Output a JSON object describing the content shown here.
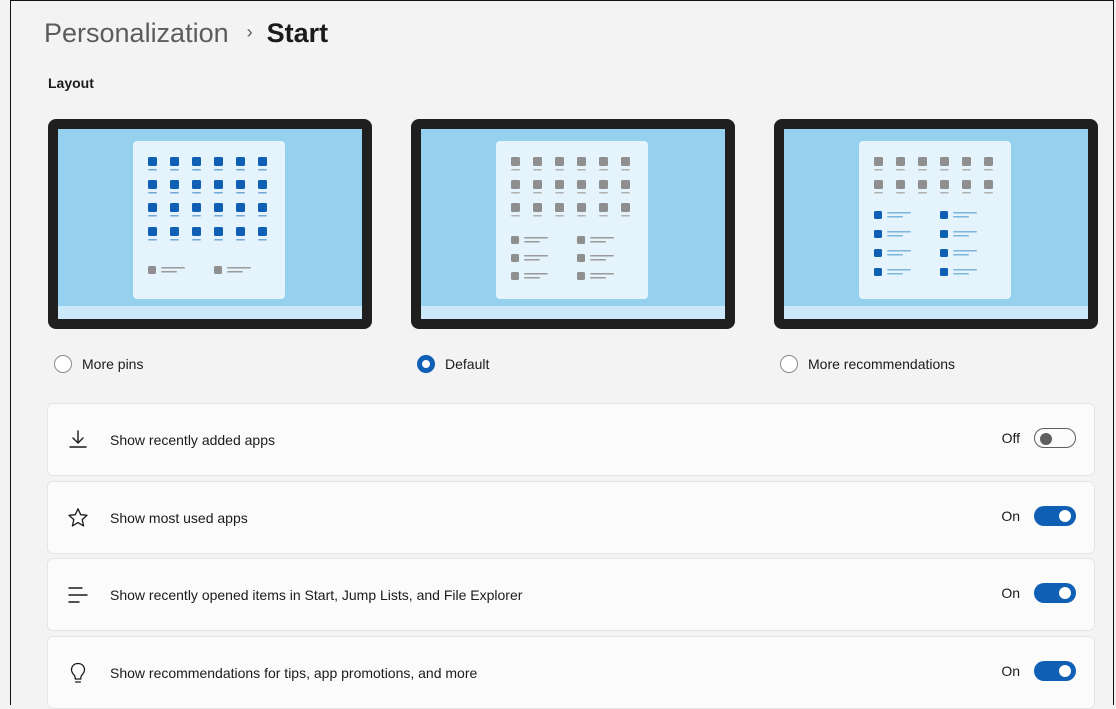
{
  "header": {
    "breadcrumb_parent": "Personalization",
    "breadcrumb_separator": "›",
    "breadcrumb_current": "Start"
  },
  "layout_section": {
    "label": "Layout",
    "options": [
      {
        "label": "More pins",
        "selected": false
      },
      {
        "label": "Default",
        "selected": true
      },
      {
        "label": "More recommendations",
        "selected": false
      }
    ]
  },
  "settings": [
    {
      "icon": "download-icon",
      "label": "Show recently added apps",
      "state": "Off",
      "on": false
    },
    {
      "icon": "star-icon",
      "label": "Show most used apps",
      "state": "On",
      "on": true
    },
    {
      "icon": "list-lines-icon",
      "label": "Show recently opened items in Start, Jump Lists, and File Explorer",
      "state": "On",
      "on": true
    },
    {
      "icon": "lightbulb-icon",
      "label": "Show recommendations for tips, app promotions, and more",
      "state": "On",
      "on": true
    }
  ],
  "colors": {
    "accent": "#0f5fb5",
    "pin_gray": "#8f8f8f",
    "screen_blue": "#95d1ef",
    "menu_bg": "#e4f3fc"
  }
}
